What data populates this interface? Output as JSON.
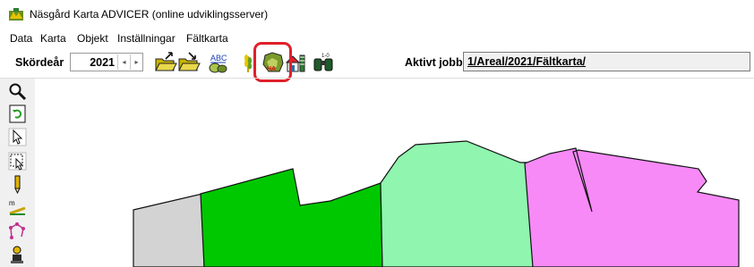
{
  "window": {
    "title": "Näsgård Karta ADVICER (online udviklingsserver)"
  },
  "menu": [
    "Data",
    "Karta",
    "Objekt",
    "Inställningar",
    "Fältkarta"
  ],
  "toolbar": {
    "year_label": "Skördeår",
    "year_value": "2021",
    "buttons": [
      "open-folder-icon",
      "save-folder-icon",
      "spellcheck-icon",
      "crop-icon",
      "field-map-icon",
      "farm-icon",
      "binoculars-icon"
    ],
    "highlighted_button": "field-map-icon",
    "active_job_label": "Aktivt jobb",
    "active_job_value": "1/Areal/2021/Fältkarta/"
  },
  "left_tools": [
    "zoom-icon",
    "refresh-icon",
    "pointer-icon",
    "select-area-icon",
    "pencil-icon",
    "measure-icon",
    "polygon-edit-icon",
    "person-icon"
  ],
  "map": {
    "fields": [
      {
        "name": "grey",
        "color": "#d3d3d3"
      },
      {
        "name": "green",
        "color": "#00c800"
      },
      {
        "name": "light-green",
        "color": "#8ff5af"
      },
      {
        "name": "magenta",
        "color": "#f78af7"
      }
    ],
    "highlight_color": "#e0202a"
  }
}
